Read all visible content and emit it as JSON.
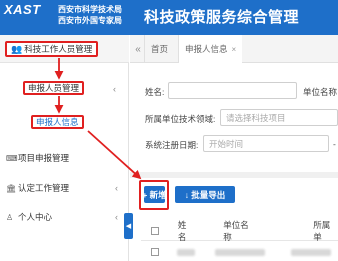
{
  "header": {
    "logo_text": "XAST",
    "org_line1": "西安市科学技术局",
    "org_line2": "西安市外国专家局",
    "app_title": "科技政策服务综合管理"
  },
  "sidebar": {
    "top_menu": {
      "label": "科技工作人员管理",
      "icon": "users-icon"
    },
    "sub_menu": {
      "label": "申报人员管理",
      "chevron": "‹"
    },
    "sub_item": {
      "label": "申报人信息"
    },
    "items": [
      {
        "label": "项目申报管理",
        "icon": "keyboard-icon"
      },
      {
        "label": "认定工作管理",
        "icon": "bank-icon",
        "chevron": "‹"
      },
      {
        "label": "个人中心",
        "icon": "user-icon",
        "chevron": "‹"
      }
    ],
    "collapse_glyph": "◀"
  },
  "tabs": {
    "prev_glyph": "«",
    "items": [
      {
        "label": "首页",
        "active": false
      },
      {
        "label": "申报人信息",
        "active": true,
        "close": "×"
      }
    ]
  },
  "filters": {
    "name_label": "姓名:",
    "unit_label": "单位名称",
    "field_label": "所属单位技术领域:",
    "field_placeholder": "请选择科技项目",
    "regdate_label": "系统注册日期:",
    "regdate_placeholder": "开始时间",
    "regdate_sep": "-"
  },
  "toolbar": {
    "add_label": "+ 新增",
    "export_label": "↓ 批量导出"
  },
  "table": {
    "columns": [
      "姓名",
      "单位名称",
      "所属单"
    ]
  },
  "colors": {
    "primary": "#1e6fc9",
    "highlight": "#e02020"
  }
}
